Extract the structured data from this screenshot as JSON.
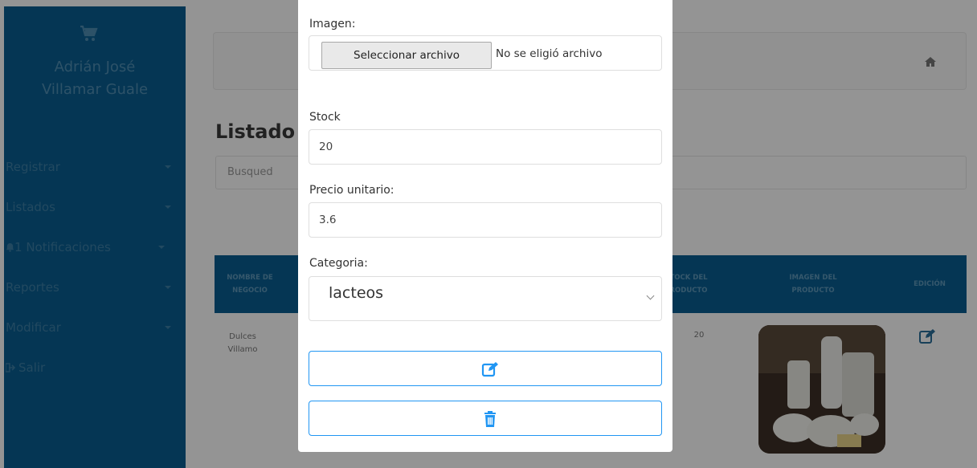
{
  "sidebar": {
    "user_name_line1": "Adrián José",
    "user_name_line2": "Villamar Guale",
    "brand_icon": "shopping-cart-icon",
    "items": [
      {
        "label": "Registrar",
        "icon": "caret-down-icon"
      },
      {
        "label": "Listados",
        "icon": "caret-down-icon"
      },
      {
        "label": "Notificaciones",
        "badge": "1",
        "icon": "bell-icon"
      },
      {
        "label": "Reportes",
        "icon": "caret-down-icon"
      },
      {
        "label": "Modificar",
        "icon": "caret-down-icon"
      },
      {
        "label": "Salir",
        "icon": "sign-out-icon"
      }
    ]
  },
  "page": {
    "title": "Listado",
    "search_placeholder": "Busqued",
    "table": {
      "headers": [
        "NOMBRE DEL NEGOCIO",
        "STOCK DEL PRODUCTO",
        "IMAGEN DEL PRODUCTO",
        "EDICIÓN"
      ],
      "header_visible": [
        "NOMBRE DE",
        "NEGOCIO",
        "TOCK DEL",
        "RODUCTO",
        "IMAGEN DEL",
        "PRODUCTO",
        "EDICIÓN"
      ],
      "row": {
        "business_line1": "Dulces",
        "business_line2": "Villamo",
        "stock": "20"
      }
    }
  },
  "modal": {
    "image_label": "Imagen:",
    "file_button": "Seleccionar archivo",
    "file_status": "No se eligió archivo",
    "stock_label": "Stock",
    "stock_value": "20",
    "price_label": "Precio unitario:",
    "price_value": "3.6",
    "category_label": "Categoria:",
    "category_value": "lacteos"
  },
  "colors": {
    "sidebar": "#0a5e91",
    "accent": "#2196f3",
    "overlay": "rgba(0,0,0,0.42)"
  }
}
